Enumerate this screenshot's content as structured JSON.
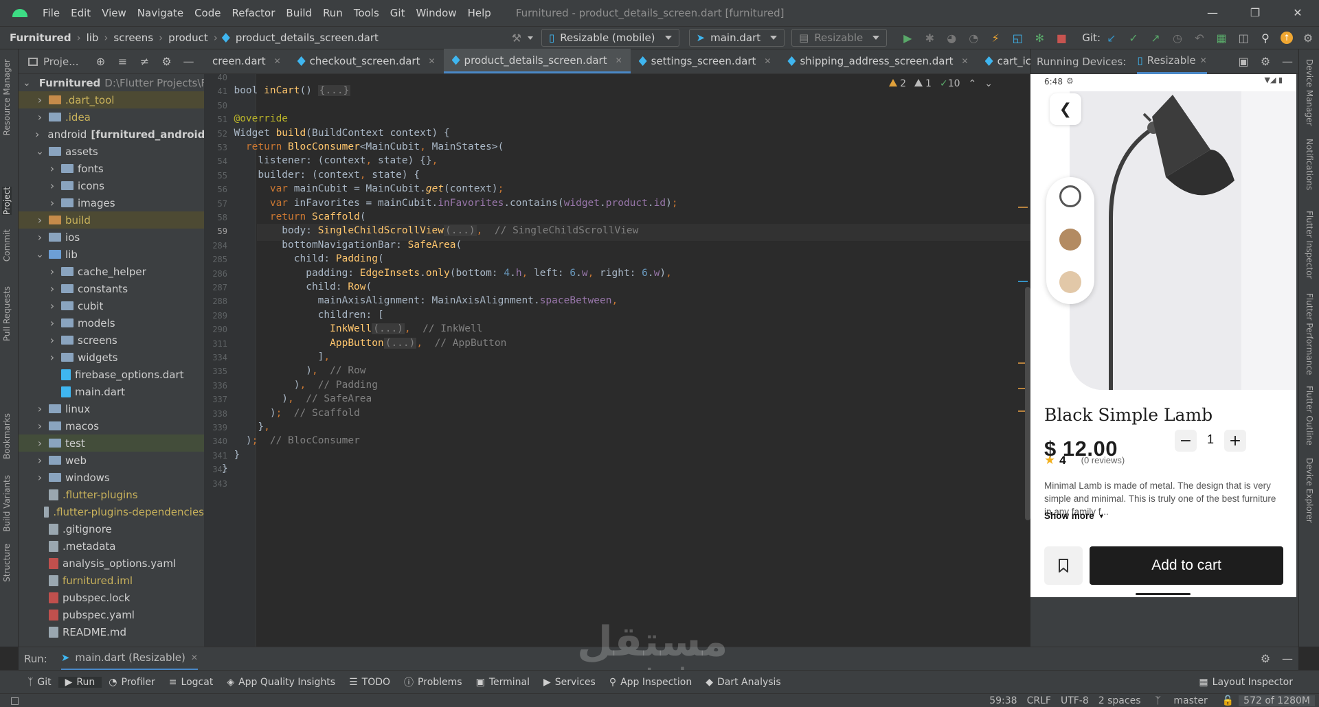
{
  "menu": {
    "items": [
      "File",
      "Edit",
      "View",
      "Navigate",
      "Code",
      "Refactor",
      "Build",
      "Run",
      "Tools",
      "Git",
      "Window",
      "Help"
    ],
    "window_title": "Furnitured - product_details_screen.dart [furnitured]"
  },
  "nav": {
    "breadcrumb": [
      "Furnitured",
      "lib",
      "screens",
      "product",
      "product_details_screen.dart"
    ],
    "device_combo": "Resizable (mobile)",
    "config_combo": "main.dart",
    "run_target": "Resizable",
    "git_label": "Git:"
  },
  "project": {
    "title": "Proje...",
    "tree": [
      {
        "label": "Furnitured",
        "suffix": "D:\\Flutter Projects\\F",
        "level": 0,
        "type": "folder",
        "open": true
      },
      {
        "label": ".dart_tool",
        "level": 1,
        "type": "folder-orange",
        "style": "olive"
      },
      {
        "label": ".idea",
        "level": 1,
        "type": "folder",
        "style": "olive"
      },
      {
        "label": "android",
        "suffix": "[furnitured_android]",
        "level": 1,
        "type": "folder"
      },
      {
        "label": "assets",
        "level": 1,
        "type": "folder",
        "open": true
      },
      {
        "label": "fonts",
        "level": 2,
        "type": "folder"
      },
      {
        "label": "icons",
        "level": 2,
        "type": "folder"
      },
      {
        "label": "images",
        "level": 2,
        "type": "folder"
      },
      {
        "label": "build",
        "level": 1,
        "type": "folder-orange",
        "style": "olive"
      },
      {
        "label": "ios",
        "level": 1,
        "type": "folder"
      },
      {
        "label": "lib",
        "level": 1,
        "type": "folder-lib",
        "open": true
      },
      {
        "label": "cache_helper",
        "level": 2,
        "type": "folder"
      },
      {
        "label": "constants",
        "level": 2,
        "type": "folder"
      },
      {
        "label": "cubit",
        "level": 2,
        "type": "folder"
      },
      {
        "label": "models",
        "level": 2,
        "type": "folder"
      },
      {
        "label": "screens",
        "level": 2,
        "type": "folder"
      },
      {
        "label": "widgets",
        "level": 2,
        "type": "folder"
      },
      {
        "label": "firebase_options.dart",
        "level": 2,
        "type": "dart",
        "leaf": true
      },
      {
        "label": "main.dart",
        "level": 2,
        "type": "dart",
        "leaf": true
      },
      {
        "label": "linux",
        "level": 1,
        "type": "folder"
      },
      {
        "label": "macos",
        "level": 1,
        "type": "folder"
      },
      {
        "label": "test",
        "level": 1,
        "type": "folder"
      },
      {
        "label": "web",
        "level": 1,
        "type": "folder"
      },
      {
        "label": "windows",
        "level": 1,
        "type": "folder"
      },
      {
        "label": ".flutter-plugins",
        "level": 1,
        "type": "file",
        "leaf": true,
        "style": "olive"
      },
      {
        "label": ".flutter-plugins-dependencies",
        "level": 1,
        "type": "file",
        "leaf": true,
        "style": "olive"
      },
      {
        "label": ".gitignore",
        "level": 1,
        "type": "file",
        "leaf": true
      },
      {
        "label": ".metadata",
        "level": 1,
        "type": "file",
        "leaf": true
      },
      {
        "label": "analysis_options.yaml",
        "level": 1,
        "type": "yaml",
        "leaf": true
      },
      {
        "label": "furnitured.iml",
        "level": 1,
        "type": "file",
        "leaf": true,
        "style": "olive"
      },
      {
        "label": "pubspec.lock",
        "level": 1,
        "type": "yaml",
        "leaf": true
      },
      {
        "label": "pubspec.yaml",
        "level": 1,
        "type": "yaml",
        "leaf": true
      },
      {
        "label": "README.md",
        "level": 1,
        "type": "file",
        "leaf": true
      }
    ]
  },
  "tabs": [
    {
      "label": "creen.dart"
    },
    {
      "label": "checkout_screen.dart"
    },
    {
      "label": "product_details_screen.dart",
      "active": true
    },
    {
      "label": "settings_screen.dart"
    },
    {
      "label": "shipping_address_screen.dart"
    },
    {
      "label": "cart_icon.dart"
    }
  ],
  "inspections": {
    "warnings": "2",
    "weak": "1",
    "typos": "10"
  },
  "code": [
    {
      "n": "40",
      "html": ""
    },
    {
      "n": "41",
      "html": "  <span class='cls'>bool</span> <span class='fn'>inCart</span>() <span class='fold-box'>{...}</span>"
    },
    {
      "n": "50",
      "html": ""
    },
    {
      "n": "51",
      "html": "  <span class='an'>@override</span>"
    },
    {
      "n": "52",
      "html": "  Widget <span class='fn'>build</span>(BuildContext context) {"
    },
    {
      "n": "53",
      "html": "    <span class='kw'>return</span> <span class='fn'>BlocConsumer</span>&lt;MainCubit<span class='kw'>,</span> MainStates&gt;("
    },
    {
      "n": "54",
      "html": "      listener: (context<span class='kw'>,</span> state) {}<span class='kw'>,</span>"
    },
    {
      "n": "55",
      "html": "      builder: (context<span class='kw'>,</span> state) {"
    },
    {
      "n": "56",
      "html": "        <span class='kw'>var</span> mainCubit = MainCubit.<span class='fn'><i>get</i></span>(context)<span class='kw'>;</span>"
    },
    {
      "n": "57",
      "html": "        <span class='kw'>var</span> inFavorites = mainCubit.<span class='pu'>inFavorites</span>.contains(<span class='pu'>widget</span>.<span class='pu'>product</span>.<span class='pu'>id</span>)<span class='kw'>;</span>"
    },
    {
      "n": "58",
      "html": "        <span class='kw'>return</span> <span class='fn'>Scaffold</span>("
    },
    {
      "n": "59",
      "html": "          body: <span class='fn'>SingleChildScrollView</span><span class='fold-box'>(...)</span><span class='kw'>,</span>  <span class='cm'>// SingleChildScrollView</span>",
      "current": true
    },
    {
      "n": "284",
      "html": "          bottomNavigationBar: <span class='fn'>SafeArea</span>("
    },
    {
      "n": "285",
      "html": "            child: <span class='fn'>Padding</span>("
    },
    {
      "n": "286",
      "html": "              padding: <span class='fn'>EdgeInsets</span>.<span class='fn'>only</span>(bottom: <span class='num'>4</span>.<span class='pu'>h</span><span class='kw'>,</span> left: <span class='num'>6</span>.<span class='pu'>w</span><span class='kw'>,</span> right: <span class='num'>6</span>.<span class='pu'>w</span>)<span class='kw'>,</span>"
    },
    {
      "n": "287",
      "html": "              child: <span class='fn'>Row</span>("
    },
    {
      "n": "288",
      "html": "                mainAxisAlignment: MainAxisAlignment.<span class='pu'>spaceBetween</span><span class='kw'>,</span>"
    },
    {
      "n": "289",
      "html": "                children: ["
    },
    {
      "n": "290",
      "html": "                  <span class='fn'>InkWell</span><span class='fold-box'>(...)</span><span class='kw'>,</span>  <span class='cm'>// InkWell</span>"
    },
    {
      "n": "311",
      "html": "                  <span class='fn'>AppButton</span><span class='fold-box'>(...)</span><span class='kw'>,</span>  <span class='cm'>// AppButton</span>"
    },
    {
      "n": "334",
      "html": "                ]<span class='kw'>,</span>"
    },
    {
      "n": "335",
      "html": "              )<span class='kw'>,</span>  <span class='cm'>// Row</span>"
    },
    {
      "n": "336",
      "html": "            )<span class='kw'>,</span>  <span class='cm'>// Padding</span>"
    },
    {
      "n": "337",
      "html": "          )<span class='kw'>,</span>  <span class='cm'>// SafeArea</span>"
    },
    {
      "n": "338",
      "html": "        )<span class='kw'>;</span>  <span class='cm'>// Scaffold</span>"
    },
    {
      "n": "339",
      "html": "      }<span class='kw'>,</span>"
    },
    {
      "n": "340",
      "html": "    )<span class='kw'>;</span>  <span class='cm'>// BlocConsumer</span>"
    },
    {
      "n": "341",
      "html": "  }"
    },
    {
      "n": "342",
      "html": "}"
    },
    {
      "n": "343",
      "html": ""
    }
  ],
  "devices": {
    "label": "Running Devices:",
    "tab": "Resizable"
  },
  "phone": {
    "time": "6:48",
    "product_title": "Black Simple Lamb",
    "price": "$ 12.00",
    "quantity": "1",
    "rating": "4",
    "reviews": "(0 reviews)",
    "description": "Minimal Lamb is made of metal. The design that is very simple and minimal. This is truly one of the best furniture in any family f...",
    "show_more": "Show more",
    "add_to_cart": "Add to cart",
    "colors": [
      "#ffffff",
      "#b38b62",
      "#e2c8a8"
    ]
  },
  "run": {
    "label": "Run:",
    "config": "main.dart (Resizable)"
  },
  "bottom_tools": [
    "Git",
    "Run",
    "Profiler",
    "Logcat",
    "App Quality Insights",
    "TODO",
    "Problems",
    "Terminal",
    "Services",
    "App Inspection",
    "Dart Analysis"
  ],
  "layout_inspector": "Layout Inspector",
  "status": {
    "position": "59:38",
    "line_ending": "CRLF",
    "encoding": "UTF-8",
    "indent": "2 spaces",
    "branch": "master",
    "memory": "572 of 1280M"
  },
  "left_strip": [
    "Resource Manager",
    "Project",
    "Commit",
    "Pull Requests",
    "Bookmarks",
    "Build Variants",
    "Structure"
  ],
  "right_strip": [
    "Device Manager",
    "Notifications",
    "Flutter Inspector",
    "Flutter Performance",
    "Flutter Outline",
    "Device Explorer"
  ],
  "watermark": {
    "arabic": "مستقل",
    "latin": "mostaql.com"
  }
}
